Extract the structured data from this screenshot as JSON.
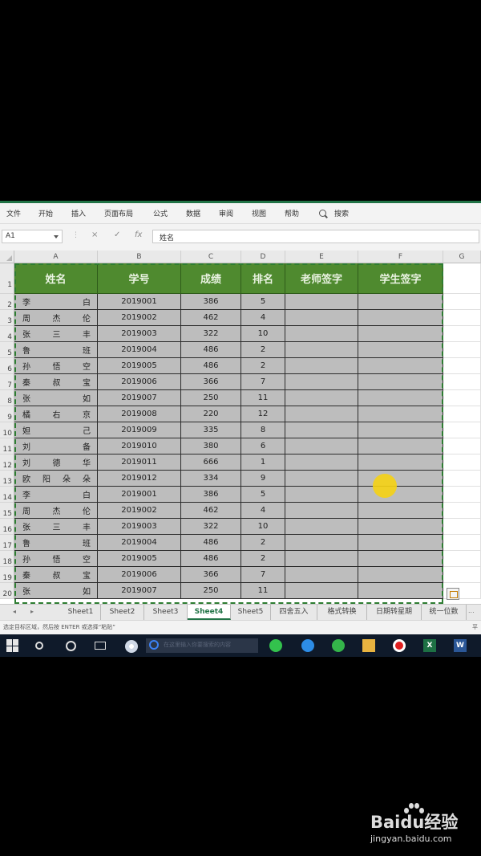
{
  "ribbon": {
    "tabs": [
      "文件",
      "开始",
      "插入",
      "页面布局",
      "公式",
      "数据",
      "审阅",
      "视图",
      "帮助"
    ],
    "search_label": "搜索"
  },
  "formula_bar": {
    "name_box": "A1",
    "cancel": "×",
    "enter": "✓",
    "fx": "fx",
    "value": "姓名"
  },
  "grid": {
    "columns": [
      "A",
      "B",
      "C",
      "D",
      "E",
      "F",
      "G"
    ],
    "rows": [
      "1",
      "2",
      "3",
      "4",
      "5",
      "6",
      "7",
      "8",
      "9",
      "10",
      "11",
      "12",
      "13",
      "14",
      "15",
      "16",
      "17",
      "18",
      "19",
      "20"
    ]
  },
  "table": {
    "headers": [
      "姓名",
      "学号",
      "成绩",
      "排名",
      "老师签字",
      "学生签字"
    ],
    "rows": [
      {
        "name": [
          "李",
          "白"
        ],
        "id": "2019001",
        "score": "386",
        "rank": "5"
      },
      {
        "name": [
          "周",
          "杰",
          "伦"
        ],
        "id": "2019002",
        "score": "462",
        "rank": "4"
      },
      {
        "name": [
          "张",
          "三",
          "丰"
        ],
        "id": "2019003",
        "score": "322",
        "rank": "10"
      },
      {
        "name": [
          "鲁",
          "班"
        ],
        "id": "2019004",
        "score": "486",
        "rank": "2"
      },
      {
        "name": [
          "孙",
          "悟",
          "空"
        ],
        "id": "2019005",
        "score": "486",
        "rank": "2"
      },
      {
        "name": [
          "秦",
          "叔",
          "宝"
        ],
        "id": "2019006",
        "score": "366",
        "rank": "7"
      },
      {
        "name": [
          "张",
          "如"
        ],
        "id": "2019007",
        "score": "250",
        "rank": "11"
      },
      {
        "name": [
          "橘",
          "右",
          "京"
        ],
        "id": "2019008",
        "score": "220",
        "rank": "12"
      },
      {
        "name": [
          "妲",
          "己"
        ],
        "id": "2019009",
        "score": "335",
        "rank": "8"
      },
      {
        "name": [
          "刘",
          "备"
        ],
        "id": "2019010",
        "score": "380",
        "rank": "6"
      },
      {
        "name": [
          "刘",
          "德",
          "华"
        ],
        "id": "2019011",
        "score": "666",
        "rank": "1"
      },
      {
        "name": [
          "欧",
          "阳",
          "朵",
          "朵"
        ],
        "id": "2019012",
        "score": "334",
        "rank": "9"
      },
      {
        "name": [
          "李",
          "白"
        ],
        "id": "2019001",
        "score": "386",
        "rank": "5"
      },
      {
        "name": [
          "周",
          "杰",
          "伦"
        ],
        "id": "2019002",
        "score": "462",
        "rank": "4"
      },
      {
        "name": [
          "张",
          "三",
          "丰"
        ],
        "id": "2019003",
        "score": "322",
        "rank": "10"
      },
      {
        "name": [
          "鲁",
          "班"
        ],
        "id": "2019004",
        "score": "486",
        "rank": "2"
      },
      {
        "name": [
          "孙",
          "悟",
          "空"
        ],
        "id": "2019005",
        "score": "486",
        "rank": "2"
      },
      {
        "name": [
          "秦",
          "叔",
          "宝"
        ],
        "id": "2019006",
        "score": "366",
        "rank": "7"
      },
      {
        "name": [
          "张",
          "如"
        ],
        "id": "2019007",
        "score": "250",
        "rank": "11"
      }
    ]
  },
  "sheet_tabs": {
    "nav_prev": "◂",
    "nav_next": "▸",
    "tabs": [
      "Sheet1",
      "Sheet2",
      "Sheet3",
      "Sheet4",
      "Sheet5",
      "四舍五入",
      "格式转换",
      "日期转星期",
      "统一位数"
    ],
    "active": "Sheet4",
    "more": "..."
  },
  "status_bar": {
    "message": "选定目标区域，然后按 ENTER 或选择“粘贴”",
    "right": "平"
  },
  "taskbar": {
    "search_placeholder": "在这里输入你要搜索的内容",
    "excel_label": "X",
    "word_label": "W"
  },
  "watermark": {
    "logo": "Baidu经验",
    "url": "jingyan.baidu.com"
  },
  "colors": {
    "header_green": "#4f8a2f",
    "cell_gray": "#bdbdbd",
    "selection_green": "#2e7d32",
    "cursor_yellow": "#f5d214"
  }
}
